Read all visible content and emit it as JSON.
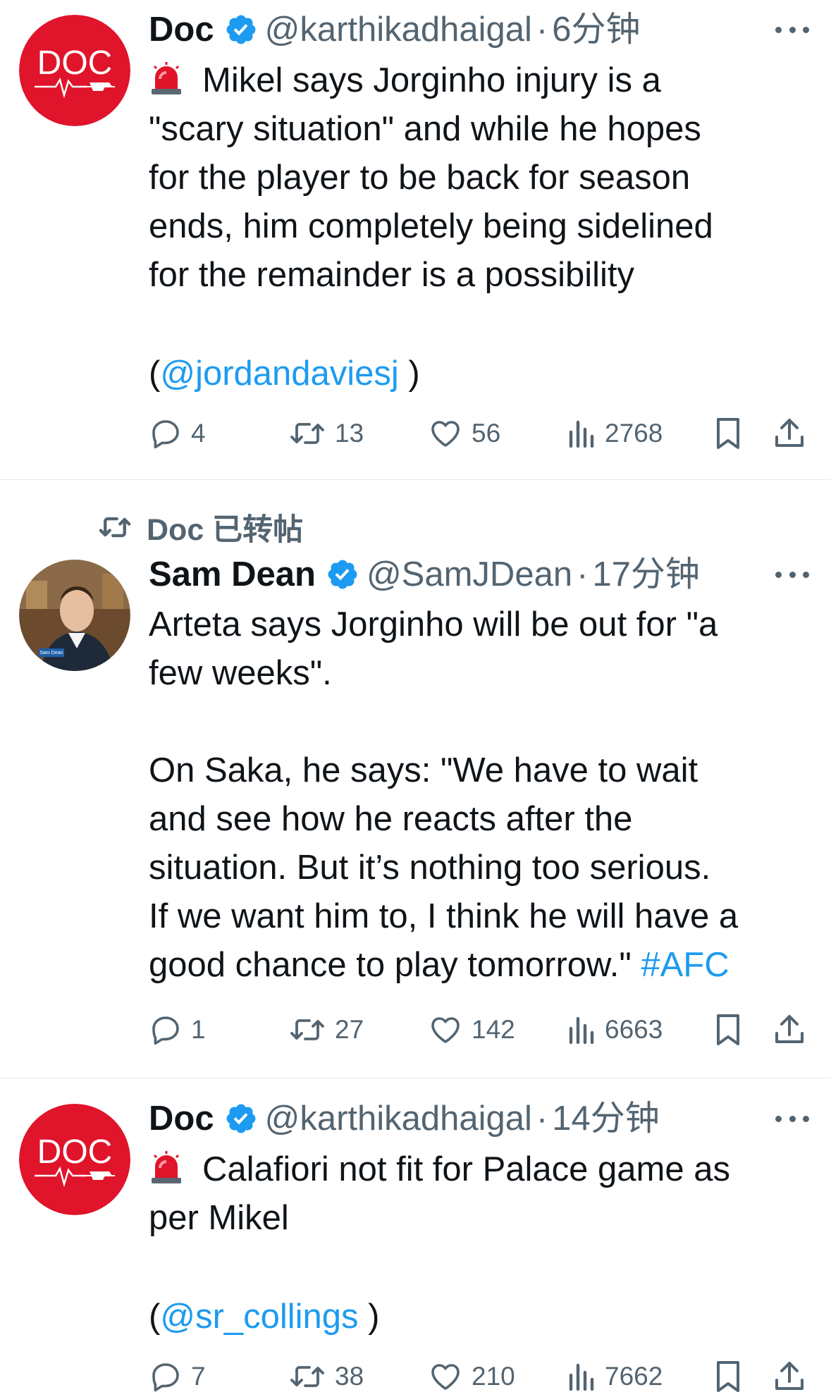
{
  "tweets": [
    {
      "author": "Doc",
      "handle": "@karthikadhaigal",
      "separator": "·",
      "time": "6分钟",
      "avatar_text": "DOC",
      "lines": [
        "Mikel says Jorginho injury is a",
        "\"scary situation\" and while he hopes",
        "for the player to be back for season",
        "ends, him completely being sidelined",
        "for the remainder is a possibility"
      ],
      "mention_open": "(",
      "mention": "@jordandaviesj",
      "mention_close": " )",
      "replies": "4",
      "reposts": "13",
      "likes": "56",
      "views": "2768"
    },
    {
      "reposted_by": "Doc 已转帖",
      "author": "Sam Dean",
      "handle": "@SamJDean",
      "separator": "·",
      "time": "17分钟",
      "avatar_caption": "Sam Dean",
      "lines": [
        "Arteta says Jorginho will be out for \"a",
        "few weeks\".",
        "",
        "On Saka, he says: \"We have to wait",
        "and see how he reacts after the",
        "situation. But it’s nothing too serious.",
        "If we want him to, I think he will have a"
      ],
      "last_line": "good chance to play tomorrow.\" ",
      "hashtag": "#AFC",
      "replies": "1",
      "reposts": "27",
      "likes": "142",
      "views": "6663"
    },
    {
      "author": "Doc",
      "handle": "@karthikadhaigal",
      "separator": "·",
      "time": "14分钟",
      "avatar_text": "DOC",
      "lines": [
        "Calafiori not fit for Palace game as",
        "per Mikel"
      ],
      "mention_open": "(",
      "mention": "@sr_collings",
      "mention_close": " )",
      "replies": "7",
      "reposts": "38",
      "likes": "210",
      "views": "7662"
    }
  ],
  "colors": {
    "text": "#0f1419",
    "secondary": "#536471",
    "link": "#1d9bf0",
    "verified": "#1d9bf0",
    "doc_red": "#e0142a"
  },
  "icons": [
    "verified-badge-icon",
    "siren-emoji-icon",
    "reply-icon",
    "repost-icon",
    "like-icon",
    "views-icon",
    "bookmark-icon",
    "share-icon",
    "more-icon"
  ]
}
